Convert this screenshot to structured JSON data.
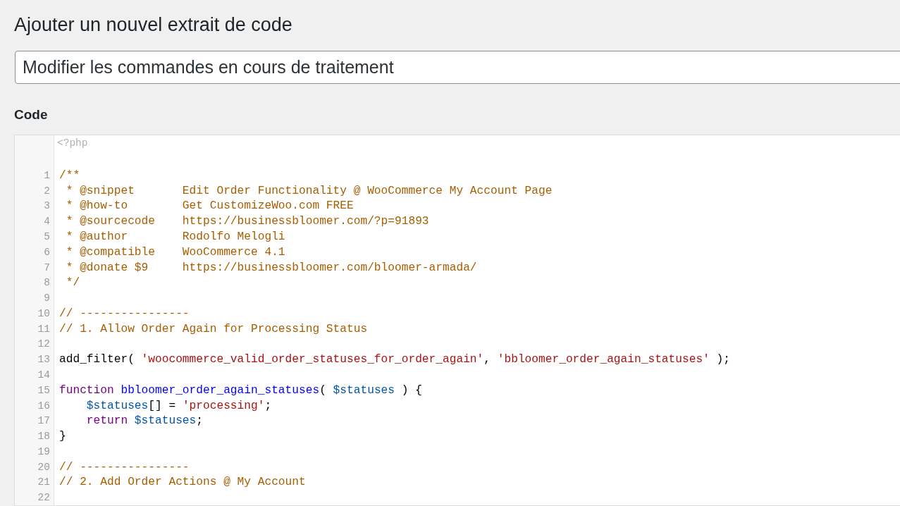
{
  "page_title": "Ajouter un nouvel extrait de code",
  "snippet_name": {
    "value": "Modifier les commandes en cours de traitement"
  },
  "code_label": "Code",
  "editor": {
    "prefix": "<?php",
    "lines": [
      {
        "number": "1",
        "tokens": [
          {
            "kind": "comment",
            "text": "/**"
          }
        ]
      },
      {
        "number": "2",
        "tokens": [
          {
            "kind": "comment",
            "text": " * @snippet       Edit Order Functionality @ WooCommerce My Account Page"
          }
        ]
      },
      {
        "number": "3",
        "tokens": [
          {
            "kind": "comment",
            "text": " * @how-to        Get CustomizeWoo.com FREE"
          }
        ]
      },
      {
        "number": "4",
        "tokens": [
          {
            "kind": "comment",
            "text": " * @sourcecode    https://businessbloomer.com/?p=91893"
          }
        ]
      },
      {
        "number": "5",
        "tokens": [
          {
            "kind": "comment",
            "text": " * @author        Rodolfo Melogli"
          }
        ]
      },
      {
        "number": "6",
        "tokens": [
          {
            "kind": "comment",
            "text": " * @compatible    WooCommerce 4.1"
          }
        ]
      },
      {
        "number": "7",
        "tokens": [
          {
            "kind": "comment",
            "text": " * @donate $9     https://businessbloomer.com/bloomer-armada/"
          }
        ]
      },
      {
        "number": "8",
        "tokens": [
          {
            "kind": "comment",
            "text": " */"
          }
        ]
      },
      {
        "number": "9"
      },
      {
        "number": "10",
        "tokens": [
          {
            "kind": "comment",
            "text": "// ----------------"
          }
        ]
      },
      {
        "number": "11",
        "tokens": [
          {
            "kind": "comment",
            "text": "// 1. Allow Order Again for Processing Status"
          }
        ]
      },
      {
        "number": "12"
      },
      {
        "number": "13",
        "tokens": [
          {
            "kind": "plain",
            "text": "add_filter( "
          },
          {
            "kind": "string",
            "text": "'woocommerce_valid_order_statuses_for_order_again'"
          },
          {
            "kind": "plain",
            "text": ", "
          },
          {
            "kind": "string",
            "text": "'bbloomer_order_again_statuses'"
          },
          {
            "kind": "plain",
            "text": " );"
          }
        ]
      },
      {
        "number": "14"
      },
      {
        "number": "15",
        "tokens": [
          {
            "kind": "keyword",
            "text": "function "
          },
          {
            "kind": "def",
            "text": "bbloomer_order_again_statuses"
          },
          {
            "kind": "plain",
            "text": "( "
          },
          {
            "kind": "variable",
            "text": "$statuses"
          },
          {
            "kind": "plain",
            "text": " ) {"
          }
        ]
      },
      {
        "number": "16",
        "tokens": [
          {
            "kind": "variable",
            "text": "    $statuses"
          },
          {
            "kind": "plain",
            "text": "[] = "
          },
          {
            "kind": "string",
            "text": "'processing'"
          },
          {
            "kind": "plain",
            "text": ";"
          }
        ]
      },
      {
        "number": "17",
        "tokens": [
          {
            "kind": "keyword",
            "text": "    return "
          },
          {
            "kind": "variable",
            "text": "$statuses"
          },
          {
            "kind": "plain",
            "text": ";"
          }
        ]
      },
      {
        "number": "18",
        "tokens": [
          {
            "kind": "plain",
            "text": "}"
          }
        ]
      },
      {
        "number": "19"
      },
      {
        "number": "20",
        "tokens": [
          {
            "kind": "comment",
            "text": "// ----------------"
          }
        ]
      },
      {
        "number": "21",
        "tokens": [
          {
            "kind": "comment",
            "text": "// 2. Add Order Actions @ My Account"
          }
        ]
      },
      {
        "number": "22"
      }
    ]
  }
}
